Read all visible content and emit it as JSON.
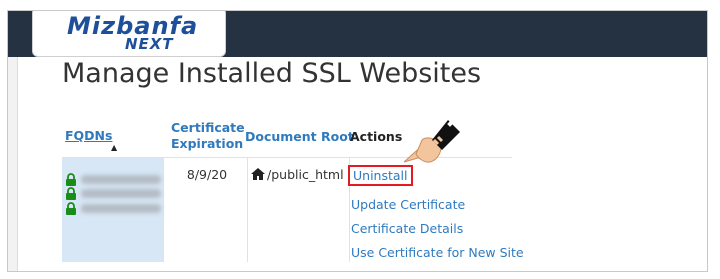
{
  "logo": {
    "main": "Mizbanfa",
    "sub": "NEXT"
  },
  "page": {
    "title": "Manage Installed SSL Websites"
  },
  "table": {
    "headers": {
      "fqdn": "FQDNs",
      "cert_expiration": "Certificate Expiration",
      "doc_root": "Document Root",
      "actions": "Actions"
    },
    "sort_indicator": "▲",
    "row": {
      "cert_expiration": "8/9/20",
      "document_root": "/public_html",
      "actions": [
        "Uninstall",
        "Update Certificate",
        "Certificate Details",
        "Use Certificate for New Site"
      ]
    }
  },
  "colors": {
    "accent": "#2f7abf",
    "highlight": "#e31b23",
    "topbar": "#253242",
    "lock": "#1a8c1a"
  },
  "icons": [
    "lock-icon",
    "home-icon",
    "pointing-hand-icon"
  ]
}
